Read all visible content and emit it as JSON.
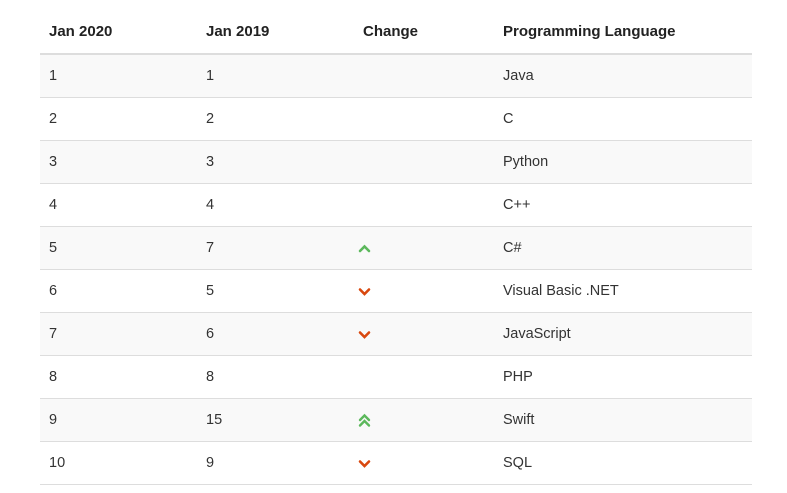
{
  "table": {
    "headers": {
      "jan2020": "Jan 2020",
      "jan2019": "Jan 2019",
      "change": "Change",
      "language": "Programming Language"
    },
    "rows": [
      {
        "jan2020": "1",
        "jan2019": "1",
        "change": "none",
        "language": "Java"
      },
      {
        "jan2020": "2",
        "jan2019": "2",
        "change": "none",
        "language": "C"
      },
      {
        "jan2020": "3",
        "jan2019": "3",
        "change": "none",
        "language": "Python"
      },
      {
        "jan2020": "4",
        "jan2019": "4",
        "change": "none",
        "language": "C++"
      },
      {
        "jan2020": "5",
        "jan2019": "7",
        "change": "up",
        "language": "C#"
      },
      {
        "jan2020": "6",
        "jan2019": "5",
        "change": "down",
        "language": "Visual Basic .NET"
      },
      {
        "jan2020": "7",
        "jan2019": "6",
        "change": "down",
        "language": "JavaScript"
      },
      {
        "jan2020": "8",
        "jan2019": "8",
        "change": "none",
        "language": "PHP"
      },
      {
        "jan2020": "9",
        "jan2019": "15",
        "change": "double-up",
        "language": "Swift"
      },
      {
        "jan2020": "10",
        "jan2019": "9",
        "change": "down",
        "language": "SQL"
      }
    ]
  },
  "colors": {
    "up": "#5cb85c",
    "down": "#d9480f",
    "stripe": "#f9f9f9",
    "border": "#dddddd"
  },
  "icons": {
    "up": "chevron-up-icon",
    "down": "chevron-down-icon",
    "double-up": "double-chevron-up-icon"
  }
}
